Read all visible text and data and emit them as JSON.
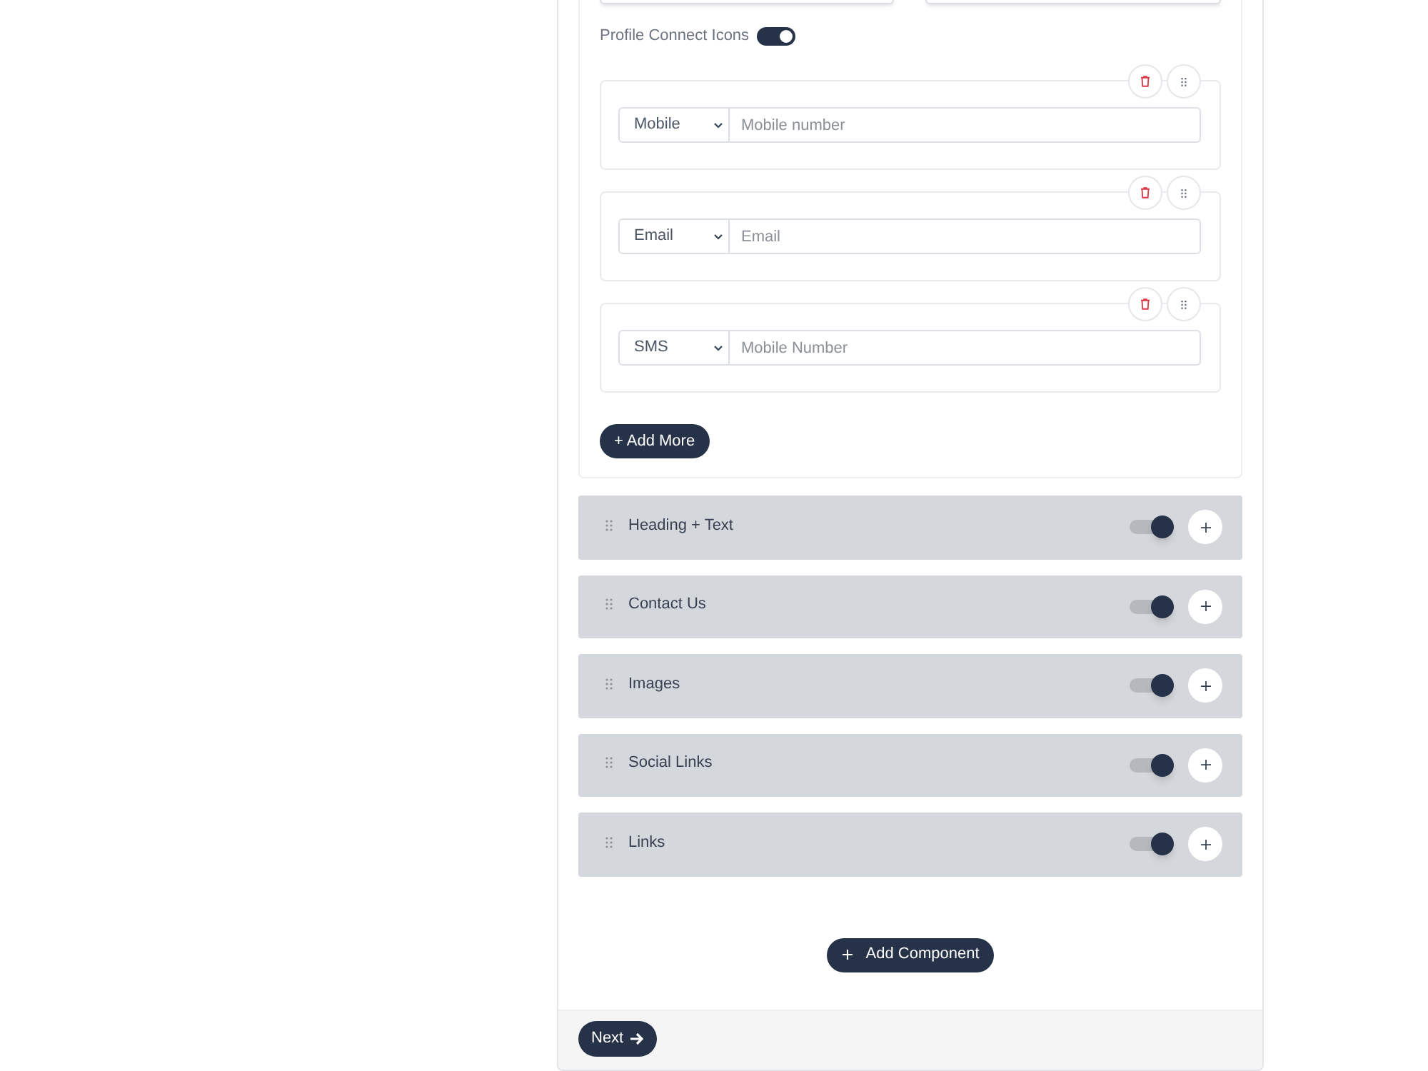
{
  "profile_connect": {
    "label": "Profile Connect Icons",
    "on": true
  },
  "contacts": [
    {
      "type": "Mobile",
      "placeholder": "Mobile number"
    },
    {
      "type": "Email",
      "placeholder": "Email"
    },
    {
      "type": "SMS",
      "placeholder": "Mobile Number"
    }
  ],
  "add_more_button": {
    "label": "+ Add More"
  },
  "components": [
    {
      "label": "Heading + Text",
      "on": true
    },
    {
      "label": "Contact Us",
      "on": true
    },
    {
      "label": "Images",
      "on": true
    },
    {
      "label": "Social Links",
      "on": true
    },
    {
      "label": "Links",
      "on": true
    }
  ],
  "add_component_button": {
    "label": "Add Component"
  },
  "next_button": {
    "label": "Next"
  }
}
